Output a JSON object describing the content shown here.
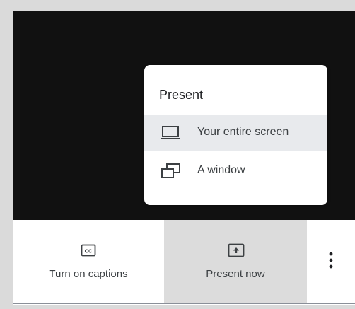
{
  "present_menu": {
    "title": "Present",
    "items": [
      {
        "label": "Your entire screen",
        "icon": "laptop-icon",
        "selected": true
      },
      {
        "label": "A window",
        "icon": "window-icon",
        "selected": false
      }
    ]
  },
  "toolbar": {
    "captions_label": "Turn on captions",
    "captions_icon": "closed-captions-icon",
    "present_label": "Present now",
    "present_icon": "present-screen-icon",
    "more_icon": "more-vert-icon"
  },
  "colors": {
    "stage": "#111111",
    "selected_item": "#e8eaed",
    "active_button": "#dcdcdc"
  }
}
